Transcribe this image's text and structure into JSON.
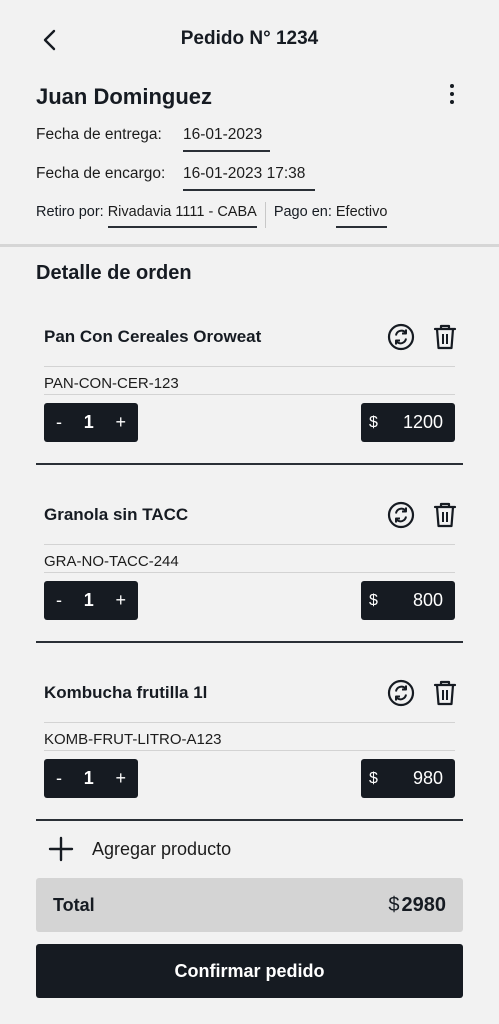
{
  "header": {
    "title": "Pedido N° 1234"
  },
  "customer": {
    "name": "Juan Dominguez",
    "delivery_label": "Fecha de entrega:",
    "delivery_value": "16-01-2023",
    "order_label": "Fecha de encargo:",
    "order_value": "16-01-2023 17:38",
    "pickup_label": "Retiro por:",
    "pickup_value": "Rivadavia 1111 - CABA",
    "payment_label": "Pago en:",
    "payment_value": "Efectivo"
  },
  "section_title": "Detalle de orden",
  "items": [
    {
      "name": "Pan Con Cereales Oroweat",
      "sku": "PAN-CON-CER-123",
      "qty": "1",
      "currency": "$",
      "price": "1200"
    },
    {
      "name": "Granola sin TACC",
      "sku": "GRA-NO-TACC-244",
      "qty": "1",
      "currency": "$",
      "price": "800"
    },
    {
      "name": "Kombucha frutilla 1l",
      "sku": "KOMB-FRUT-LITRO-A123",
      "qty": "1",
      "currency": "$",
      "price": "980"
    }
  ],
  "stepper": {
    "minus": "-",
    "plus": "+"
  },
  "add_product": "Agregar producto",
  "total": {
    "label": "Total",
    "currency": "$",
    "amount": "2980"
  },
  "confirm": "Confirmar pedido",
  "icons": {
    "back": "chevron-left-icon",
    "menu": "more-vertical-icon",
    "swap": "swap-circle-icon",
    "trash": "trash-icon",
    "add": "plus-icon"
  },
  "colors": {
    "primary": "#161b22",
    "background": "#f2f2f2",
    "total_bg": "#d4d4d4"
  }
}
